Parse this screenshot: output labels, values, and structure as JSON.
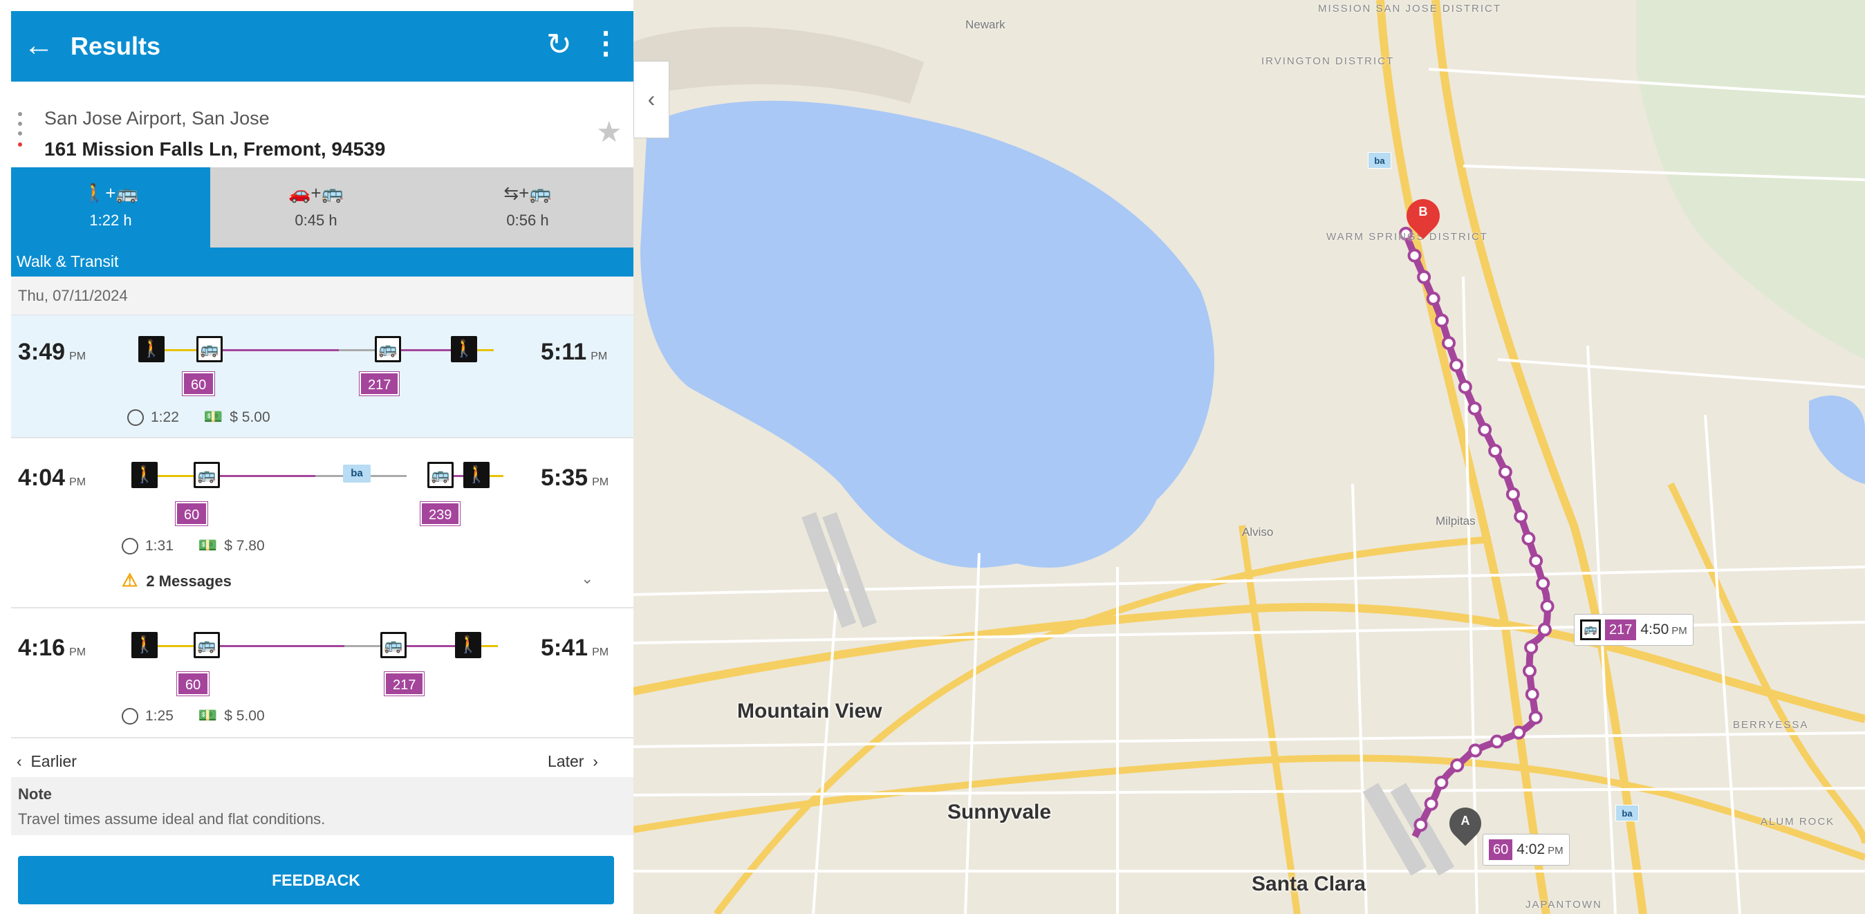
{
  "header": {
    "back_icon": "arrow-left-icon",
    "title": "Results",
    "refresh_icon": "refresh-icon",
    "menu_icon": "more-vert-icon"
  },
  "route": {
    "from": "San Jose Airport, San Jose",
    "to": "161 Mission Falls Ln, Fremont, 94539",
    "favorite_icon": "star-icon"
  },
  "modes": [
    {
      "icon": "🚶+🚌",
      "time": "1:22 h",
      "active": true
    },
    {
      "icon": "🚗+🚌",
      "time": "0:45 h",
      "active": false
    },
    {
      "icon": "⇆+🚌",
      "time": "0:56 h",
      "active": false
    }
  ],
  "mode_label": "Walk & Transit",
  "date": "Thu, 07/11/2024",
  "trips": [
    {
      "depart": "3:49",
      "depart_ampm": "PM",
      "arrive": "5:11",
      "arrive_ampm": "PM",
      "routes": [
        "60",
        "217"
      ],
      "duration": "1:22",
      "fare": "$ 5.00"
    },
    {
      "depart": "4:04",
      "depart_ampm": "PM",
      "arrive": "5:35",
      "arrive_ampm": "PM",
      "routes": [
        "60",
        "239"
      ],
      "duration": "1:31",
      "fare": "$ 7.80",
      "messages": "2 Messages"
    },
    {
      "depart": "4:16",
      "depart_ampm": "PM",
      "arrive": "5:41",
      "arrive_ampm": "PM",
      "routes": [
        "60",
        "217"
      ],
      "duration": "1:25",
      "fare": "$ 5.00"
    }
  ],
  "pager": {
    "earlier": "Earlier",
    "later": "Later"
  },
  "note": {
    "title": "Note",
    "body": "Travel times assume ideal and flat conditions."
  },
  "feedback_label": "FEEDBACK",
  "map": {
    "cities": [
      "Mountain View",
      "Sunnyvale",
      "Santa Clara"
    ],
    "small_labels": [
      "Newark",
      "Milpitas",
      "Alviso"
    ],
    "districts": [
      "MISSION SAN JOSE DISTRICT",
      "IRVINGTON DISTRICT",
      "WARM SPRINGS DISTRICT",
      "BERRYESSA",
      "ALUM ROCK",
      "JAPANTOWN"
    ],
    "pin_a": "A",
    "pin_b": "B",
    "callout_a": {
      "route": "60",
      "time": "4:02",
      "ampm": "PM"
    },
    "callout_b": {
      "route": "217",
      "time": "4:50",
      "ampm": "PM"
    },
    "transit_icon_label": "ba",
    "route_color": "#a4459b",
    "water_color": "#a9c8f5",
    "land_color": "#ece8dc"
  },
  "colors": {
    "primary": "#0a8ed1",
    "route_badge": "#a4459b",
    "walk": "#e6c200"
  }
}
